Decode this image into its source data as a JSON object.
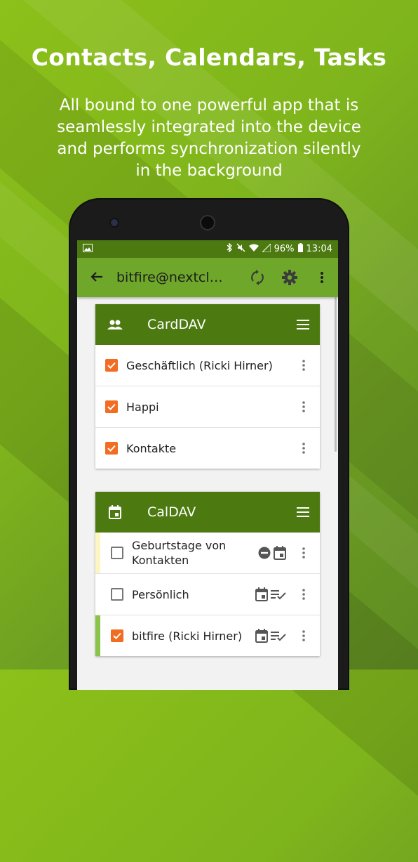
{
  "hero": {
    "title": "Contacts, Calendars, Tasks",
    "subtitle_lines": [
      "All bound to one powerful app that is",
      "seamlessly integrated into the device",
      "and performs synchronization silently",
      "in the background"
    ]
  },
  "statusbar": {
    "battery": "96%",
    "time": "13:04"
  },
  "appbar": {
    "title": "bitfire@nextcl…"
  },
  "carddav": {
    "title": "CardDAV",
    "items": [
      {
        "label": "Geschäftlich (Ricki Hirner)",
        "checked": true
      },
      {
        "label": "Happi",
        "checked": true
      },
      {
        "label": "Kontakte",
        "checked": true
      }
    ]
  },
  "caldav": {
    "title": "CalDAV",
    "items": [
      {
        "label": "Geburtstage von Kontakten",
        "checked": false,
        "color": "#fdf6c3",
        "icons": [
          "read-only-icon",
          "calendar-icon"
        ]
      },
      {
        "label": "Persönlich",
        "checked": false,
        "color": "",
        "icons": [
          "calendar-icon",
          "tasks-icon"
        ]
      },
      {
        "label": "bitfire (Ricki Hirner)",
        "checked": true,
        "color": "#8bc34a",
        "icons": [
          "calendar-icon",
          "tasks-icon"
        ]
      }
    ]
  },
  "colors": {
    "accent": "#f26d21",
    "primary_dark": "#4c7a10",
    "primary": "#6fa72a"
  }
}
